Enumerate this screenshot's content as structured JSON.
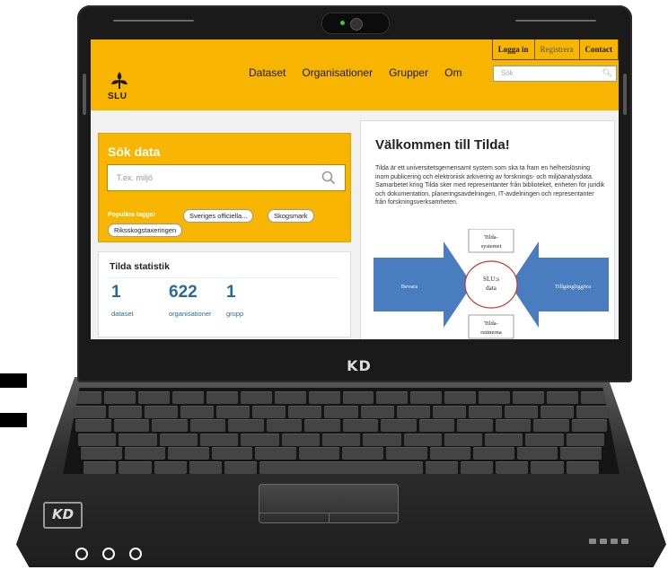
{
  "brand": {
    "bezel_text": "KD",
    "sticker_text": "KD"
  },
  "header": {
    "top_links": [
      "Logga in",
      "Registrera",
      "Contact"
    ],
    "logo_text": "SLU",
    "nav": [
      "Dataset",
      "Organisationer",
      "Grupper",
      "Om"
    ],
    "search_placeholder": "Sök"
  },
  "search_panel": {
    "title": "Sök data",
    "placeholder": "T.ex. miljö",
    "tags_label": "Populära taggar",
    "tags": [
      "Sveriges officiella...",
      "Skogsmark",
      "Riksskogstaxeringen"
    ]
  },
  "stats": {
    "title": "Tilda statistik",
    "items": [
      {
        "value": "1",
        "label": "dataset"
      },
      {
        "value": "622",
        "label": "organisationer"
      },
      {
        "value": "1",
        "label": "grupp"
      }
    ]
  },
  "welcome": {
    "title": "Välkommen till Tilda!",
    "body": "Tilda är ett universitetsgemensamt system som ska ta fram en helhetslösning inom publicering och elektronisk arkivering av forsknings- och miljöanalysdata. Samarbetet kring Tilda sker med representanter från biblioteket, enheten för juridik och dokumentation, planeringsavdelningen, IT-avdelningen och representanter från forskningsverksamheten."
  },
  "diagram": {
    "left_arrow": "Bevara",
    "right_arrow": "Tillgängliggöra",
    "center": [
      "SLU:s",
      "data"
    ],
    "top_box": [
      "Tilda-",
      "systemet"
    ],
    "bottom_box": [
      "Tilda-",
      "rutinerna"
    ]
  },
  "colors": {
    "accent": "#f7b500",
    "link": "#2a6a9a",
    "arrow": "#4a7cc0"
  }
}
